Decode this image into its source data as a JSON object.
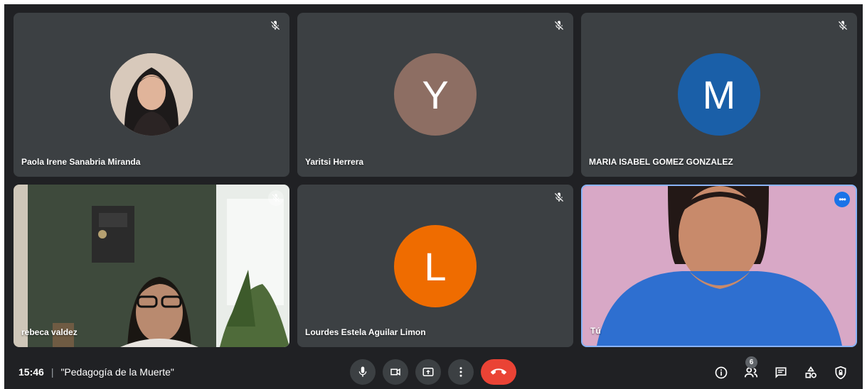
{
  "participants": [
    {
      "name": "Paola Irene Sanabria Miranda",
      "type": "photo"
    },
    {
      "name": "Yaritsi Herrera",
      "type": "initial",
      "initial": "Y",
      "color": "#8d6e63"
    },
    {
      "name": "MARIA ISABEL GOMEZ GONZALEZ",
      "type": "initial",
      "initial": "M",
      "color": "#1a5fa8"
    },
    {
      "name": "rebeca valdez",
      "type": "video"
    },
    {
      "name": "Lourdes Estela Aguilar Limon",
      "type": "initial",
      "initial": "L",
      "color": "#ef6c00"
    },
    {
      "name": "Tú",
      "type": "video"
    }
  ],
  "meeting": {
    "time": "15:46",
    "separator": "|",
    "title": "\"Pedagogía de la Muerte\""
  },
  "toolbar": {
    "participants_count": "6"
  },
  "colors": {
    "background": "#202124",
    "tile": "#3c4043",
    "end_call": "#ea4335",
    "accent": "#1a73e8"
  },
  "icons": [
    "mic-off-icon",
    "mic-icon",
    "camera-icon",
    "present-screen-icon",
    "more-vert-icon",
    "call-end-icon",
    "info-icon",
    "people-icon",
    "chat-icon",
    "activities-icon",
    "host-controls-icon"
  ]
}
